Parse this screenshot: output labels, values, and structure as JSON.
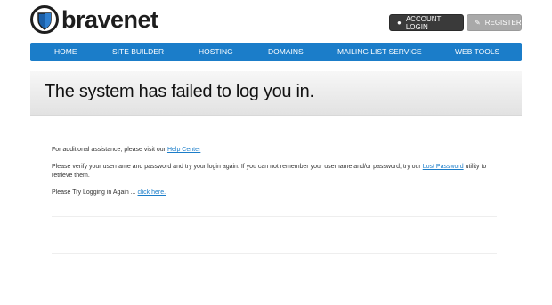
{
  "header": {
    "logo_text": "bravenet",
    "buttons": {
      "login": {
        "label": "ACCOUNT LOGIN",
        "icon": "user-icon"
      },
      "register": {
        "label": "REGISTER",
        "icon": "pencil-icon"
      }
    }
  },
  "nav": {
    "items": [
      {
        "label": "HOME"
      },
      {
        "label": "SITE BUILDER"
      },
      {
        "label": "HOSTING"
      },
      {
        "label": "DOMAINS"
      },
      {
        "label": "MAILING LIST SERVICE"
      },
      {
        "label": "WEB TOOLS"
      }
    ]
  },
  "banner": {
    "title": "The system has failed to log you in."
  },
  "content": {
    "assist_text": "For additional assistance, please visit our",
    "help_link": "Help Center",
    "verify_text": "Please verify your username and password and try your login again. If you can not remember your username and/or password, try our",
    "lost_password_link": "Lost Password",
    "verify_text_after": "utility to retrieve them.",
    "retry_text": "Please Try Logging in Again ...",
    "click_here_link": "click here."
  },
  "colors": {
    "nav_blue": "#1b7dc9",
    "login_button": "#3a3a3a",
    "register_button": "#a9a9a9",
    "link": "#1b7dc9"
  }
}
